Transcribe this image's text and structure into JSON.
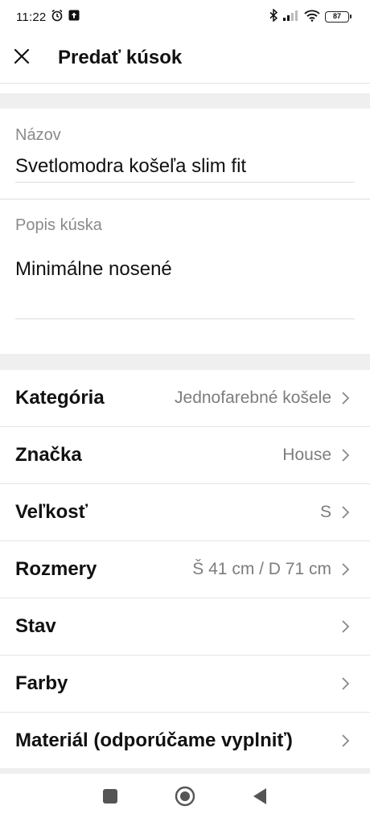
{
  "status_bar": {
    "time": "11:22",
    "battery": "87"
  },
  "header": {
    "title": "Predať kúsok"
  },
  "form": {
    "name_label": "Názov",
    "name_value": "Svetlomodra košeľa slim fit",
    "description_label": "Popis kúska",
    "description_value": "Minimálne nosené"
  },
  "options": [
    {
      "label": "Kategória",
      "value": "Jednofarebné košele"
    },
    {
      "label": "Značka",
      "value": "House"
    },
    {
      "label": "Veľkosť",
      "value": "S"
    },
    {
      "label": "Rozmery",
      "value": "Š 41 cm / D 71 cm"
    },
    {
      "label": "Stav",
      "value": ""
    },
    {
      "label": "Farby",
      "value": ""
    },
    {
      "label": "Materiál (odporúčame vyplniť)",
      "value": ""
    }
  ],
  "icons": {
    "close": "close-icon",
    "chevron": "chevron-right-icon",
    "nav_recents": "square-icon",
    "nav_home": "circle-icon",
    "nav_back": "back-triangle-icon"
  },
  "colors": {
    "text_primary": "#111111",
    "text_secondary": "#8a8a8a",
    "section_gap": "#efefef"
  }
}
